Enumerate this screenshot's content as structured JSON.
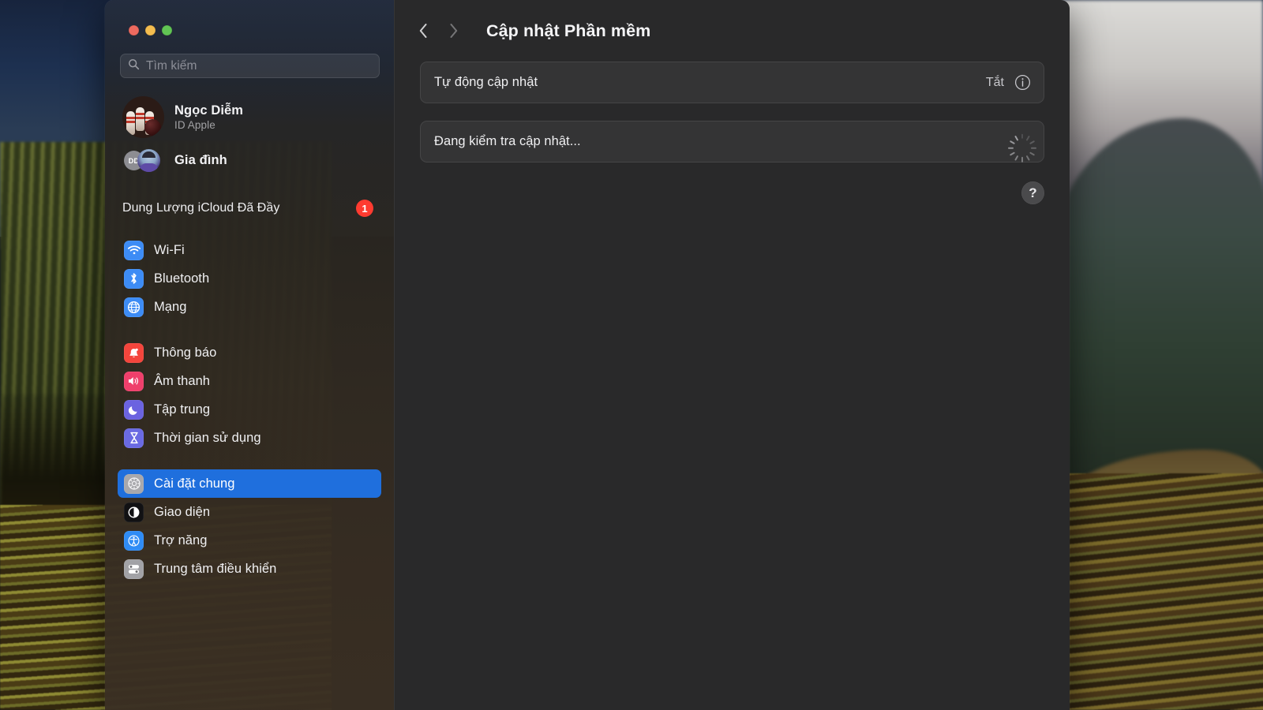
{
  "window": {
    "traffic_lights": [
      {
        "name": "close",
        "color": "#ed6a5f"
      },
      {
        "name": "minimize",
        "color": "#f4bd4f"
      },
      {
        "name": "zoom",
        "color": "#61c554"
      }
    ]
  },
  "sidebar": {
    "search": {
      "placeholder": "Tìm kiếm",
      "value": ""
    },
    "account": {
      "name": "Ngọc Diễm",
      "subtitle": "ID Apple"
    },
    "family": {
      "label": "Gia đình",
      "badge_initials": "DD"
    },
    "alert": {
      "label": "Dung Lượng iCloud Đã Đầy",
      "badge": "1",
      "badge_color": "#ff3b30"
    },
    "groups": [
      {
        "items": [
          {
            "label": "Wi-Fi",
            "icon": "wifi-icon",
            "icon_color": "#3d8cf5",
            "selected": false
          },
          {
            "label": "Bluetooth",
            "icon": "bluetooth-icon",
            "icon_color": "#3d8cf5",
            "selected": false
          },
          {
            "label": "Mạng",
            "icon": "globe-icon",
            "icon_color": "#3d8cf5",
            "selected": false
          }
        ]
      },
      {
        "items": [
          {
            "label": "Thông báo",
            "icon": "bell-icon",
            "icon_color": "#f4453c",
            "selected": false
          },
          {
            "label": "Âm thanh",
            "icon": "speaker-icon",
            "icon_color": "#ef3f6b",
            "selected": false
          },
          {
            "label": "Tập trung",
            "icon": "moon-icon",
            "icon_color": "#6b63e0",
            "selected": false
          },
          {
            "label": "Thời gian sử dụng",
            "icon": "hourglass-icon",
            "icon_color": "#6a6ae2",
            "selected": false
          }
        ]
      },
      {
        "items": [
          {
            "label": "Cài đặt chung",
            "icon": "gear-icon",
            "icon_color": "#a8a8ac",
            "selected": true
          },
          {
            "label": "Giao diện",
            "icon": "appearance-icon",
            "icon_color": "#111113",
            "selected": false
          },
          {
            "label": "Trợ năng",
            "icon": "accessibility-icon",
            "icon_color": "#2f8cf5",
            "selected": false
          },
          {
            "label": "Trung tâm điều khiển",
            "icon": "control-center-icon",
            "icon_color": "#a2a2a6",
            "selected": false
          }
        ]
      }
    ],
    "selected_accent": "#1f6fdd"
  },
  "content": {
    "title": "Cập nhật Phần mềm",
    "nav": {
      "back": "back-chevron",
      "forward": "forward-chevron"
    },
    "rows": [
      {
        "label": "Tự động cập nhật",
        "value": "Tắt",
        "trailing_icon": "info-icon"
      },
      {
        "label": "Đang kiểm tra cập nhật...",
        "value": "",
        "trailing_icon": "spinner-icon"
      }
    ],
    "help_label": "?"
  }
}
